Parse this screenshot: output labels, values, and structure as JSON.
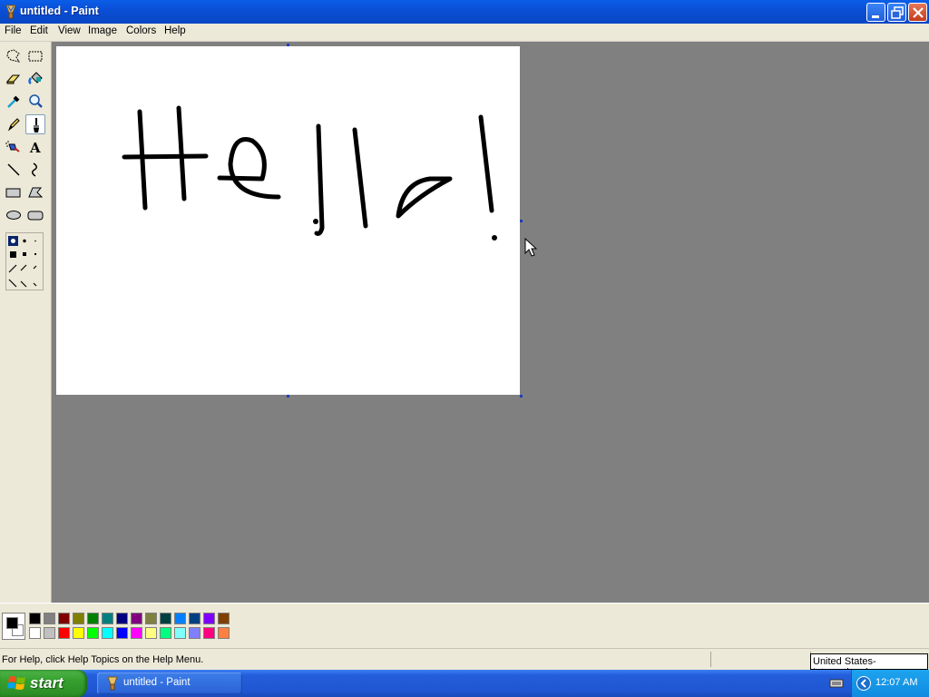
{
  "window": {
    "title": "untitled - Paint"
  },
  "menu": [
    {
      "label": "File"
    },
    {
      "label": "Edit"
    },
    {
      "label": "View"
    },
    {
      "label": "Image"
    },
    {
      "label": "Colors"
    },
    {
      "label": "Help"
    }
  ],
  "toolbox": {
    "tools": [
      {
        "name": "free-form-select"
      },
      {
        "name": "rectangle-select"
      },
      {
        "name": "eraser"
      },
      {
        "name": "fill-with-color"
      },
      {
        "name": "pick-color"
      },
      {
        "name": "magnifier"
      },
      {
        "name": "pencil"
      },
      {
        "name": "brush",
        "active": true
      },
      {
        "name": "airbrush"
      },
      {
        "name": "text"
      },
      {
        "name": "line"
      },
      {
        "name": "curve"
      },
      {
        "name": "rectangle"
      },
      {
        "name": "polygon"
      },
      {
        "name": "ellipse"
      },
      {
        "name": "rounded-rectangle"
      }
    ],
    "active_tool": "brush"
  },
  "palette": {
    "foreground": "#000000",
    "background": "#FFFFFF",
    "top_row": [
      "#000000",
      "#808080",
      "#800000",
      "#808000",
      "#008000",
      "#008080",
      "#000080",
      "#800080",
      "#808040",
      "#004040",
      "#0080FF",
      "#004080",
      "#8000FF",
      "#804000"
    ],
    "bottom_row": [
      "#FFFFFF",
      "#C0C0C0",
      "#FF0000",
      "#FFFF00",
      "#00FF00",
      "#00FFFF",
      "#0000FF",
      "#FF00FF",
      "#FFFF80",
      "#00FF80",
      "#80FFFF",
      "#8080FF",
      "#FF0080",
      "#FF8040"
    ]
  },
  "status": {
    "help_text": "For Help, click Help Topics on the Help Menu."
  },
  "language_bar": {
    "label": "United States-International"
  },
  "taskbar": {
    "start_label": "start",
    "task_label": "untitled - Paint",
    "clock": "12:07 AM"
  }
}
